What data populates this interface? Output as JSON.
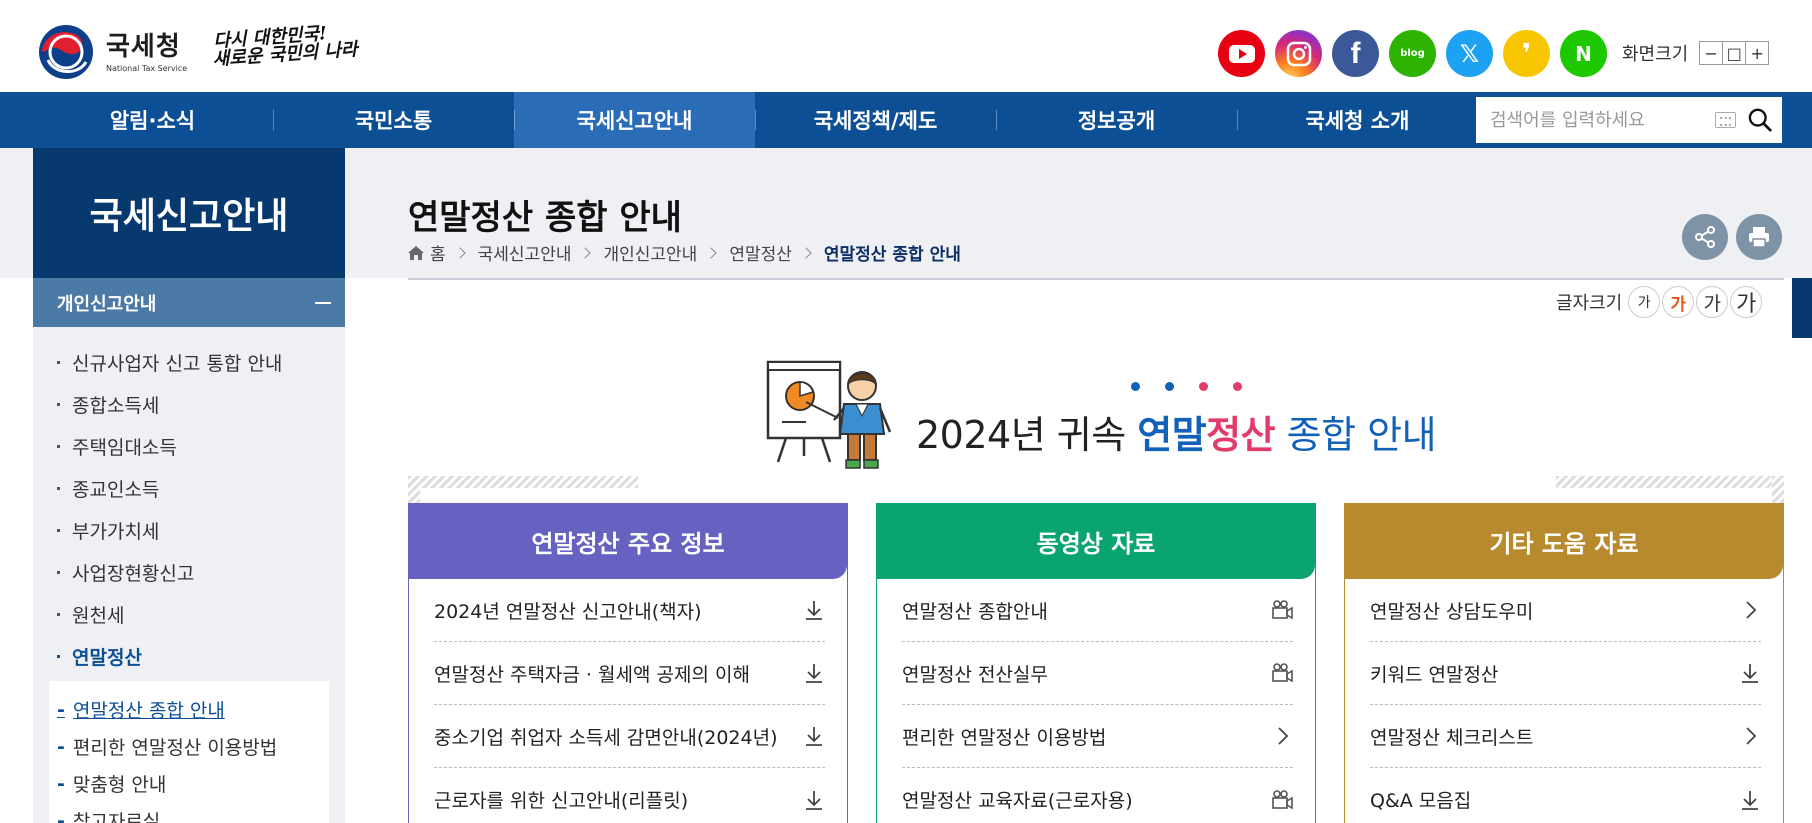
{
  "header": {
    "logo_ko": "국세청",
    "logo_en": "National Tax Service",
    "slogan_line1": "다시 대한민국!",
    "slogan_line2": "새로운 국민의 나라",
    "social": [
      {
        "name": "youtube-icon",
        "glyph": ""
      },
      {
        "name": "instagram-icon",
        "glyph": ""
      },
      {
        "name": "facebook-icon",
        "glyph": "f"
      },
      {
        "name": "blog-icon",
        "glyph": "blog"
      },
      {
        "name": "x-icon",
        "glyph": "𝕏"
      },
      {
        "name": "kakao-icon",
        "glyph": "❜"
      },
      {
        "name": "naver-post-icon",
        "glyph": "N"
      }
    ],
    "screen_size_label": "화면크기",
    "screen_size_minus": "−",
    "screen_size_reset": "□",
    "screen_size_plus": "+"
  },
  "gnb": {
    "items": [
      "알림·소식",
      "국민소통",
      "국세신고안내",
      "국세정책/제도",
      "정보공개",
      "국세청 소개"
    ],
    "active_index": 2,
    "search_placeholder": "검색어를 입력하세요"
  },
  "lnb": {
    "title": "국세신고안내",
    "section": "개인신고안내",
    "items": [
      "신규사업자 신고 통합 안내",
      "종합소득세",
      "주택임대소득",
      "종교인소득",
      "부가가치세",
      "사업장현황신고",
      "원천세",
      "연말정산"
    ],
    "active_item": "연말정산",
    "depth_items": [
      "연말정산 종합 안내",
      "편리한 연말정산 이용방법",
      "맞춤형 안내",
      "참고자료실"
    ],
    "depth_active": "연말정산 종합 안내"
  },
  "content": {
    "page_title": "연말정산 종합 안내",
    "breadcrumb": [
      "홈",
      "국세신고안내",
      "개인신고안내",
      "연말정산",
      "연말정산 종합 안내"
    ],
    "fontsize_label": "글자크기",
    "fontsize_buttons": [
      "가",
      "가",
      "가",
      "가"
    ],
    "banner": {
      "prefix": "2024년 귀속 ",
      "hl1": "연말",
      "hl2": "정산",
      "suffix": " 종합 안내",
      "dot_colors": [
        "#1261b8",
        "#1261b8",
        "#e4396b",
        "#e4396b"
      ]
    },
    "cards": [
      {
        "title": "연말정산 주요 정보",
        "color": "#6761c2",
        "rows": [
          {
            "label": "2024년 연말정산 신고안내(책자)",
            "icon": "download-icon"
          },
          {
            "label": "연말정산 주택자금 · 월세액 공제의 이해",
            "icon": "download-icon"
          },
          {
            "label": "중소기업 취업자 소득세 감면안내(2024년)",
            "icon": "download-icon"
          },
          {
            "label": "근로자를 위한 신고안내(리플릿)",
            "icon": "download-icon"
          }
        ]
      },
      {
        "title": "동영상 자료",
        "color": "#0aa56f",
        "rows": [
          {
            "label": "연말정산 종합안내",
            "icon": "video-icon"
          },
          {
            "label": "연말정산 전산실무",
            "icon": "video-icon"
          },
          {
            "label": "편리한 연말정산 이용방법",
            "icon": "chevron-right-icon"
          },
          {
            "label": "연말정산 교육자료(근로자용)",
            "icon": "video-icon"
          }
        ]
      },
      {
        "title": "기타 도움 자료",
        "color": "#b88a2e",
        "rows": [
          {
            "label": "연말정산 상담도우미",
            "icon": "chevron-right-icon"
          },
          {
            "label": "키워드 연말정산",
            "icon": "download-icon"
          },
          {
            "label": "연말정산 체크리스트",
            "icon": "chevron-right-icon"
          },
          {
            "label": "Q&A 모음집",
            "icon": "download-icon"
          }
        ]
      }
    ]
  }
}
